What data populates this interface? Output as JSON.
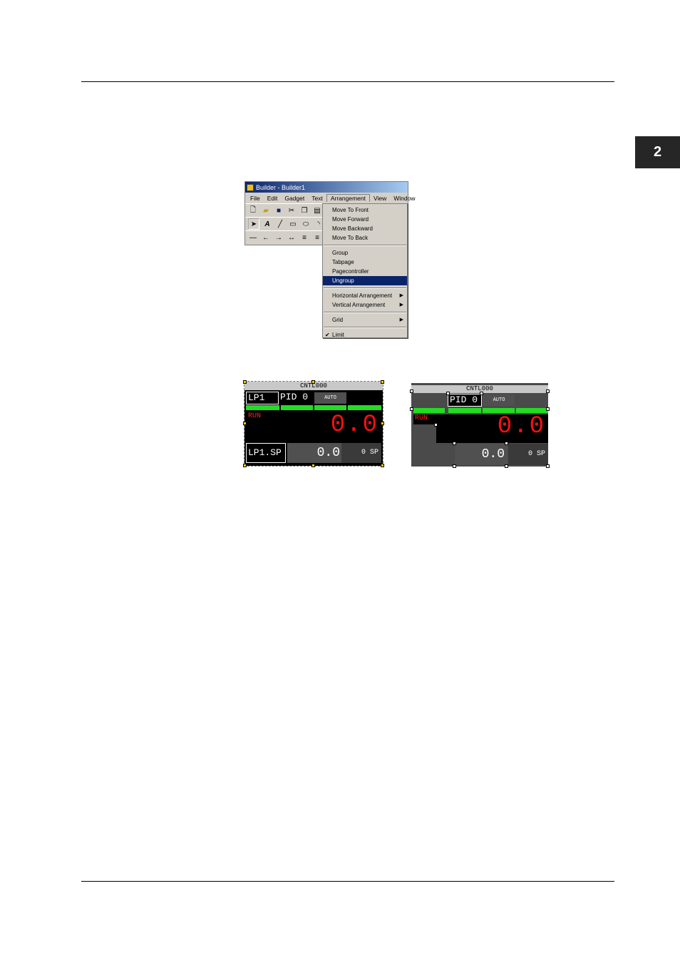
{
  "page": {
    "chapter_number": "2"
  },
  "window": {
    "title": "Builder - Builder1",
    "menu": [
      "File",
      "Edit",
      "Gadget",
      "Text",
      "Arrangement",
      "View",
      "Window"
    ]
  },
  "arrangement_menu": {
    "group1": [
      "Move To Front",
      "Move Forward",
      "Move Backward",
      "Move To Back"
    ],
    "group2": [
      "Group",
      "Tabpage",
      "Pagecontroller",
      "Ungroup"
    ],
    "group3": [
      "Horizontal Arrangement",
      "Vertical Arrangement"
    ],
    "group4": [
      "Grid"
    ],
    "group5": [
      "Limit"
    ]
  },
  "faceplate_grouped": {
    "header": "CNTL000",
    "tag": "LP1",
    "mode": "PID 0",
    "auto": "AUTO",
    "status": "RUN",
    "pv": "0.0",
    "sp_label": "LP1.SP",
    "sp": "0.0",
    "sp_unit": "0 SP"
  },
  "faceplate_ungrouped": {
    "header": "CNTL000",
    "mode": "PID 0",
    "auto": "AUTO",
    "status": "RUN",
    "pv": "0.0",
    "sp": "0.0",
    "sp_unit": "0 SP"
  }
}
